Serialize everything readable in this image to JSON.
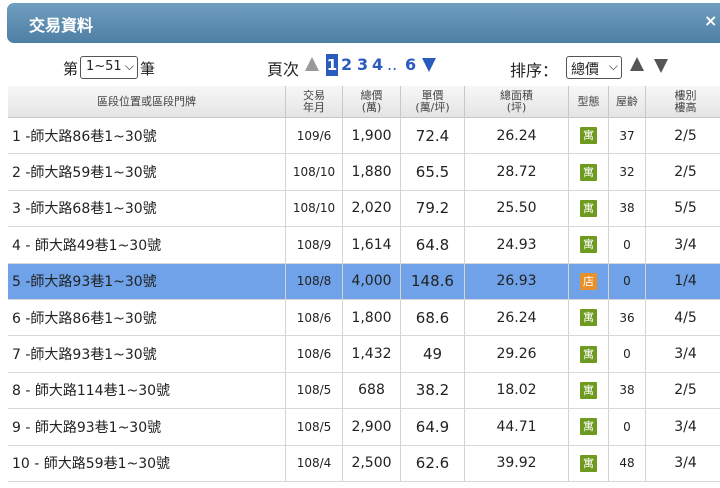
{
  "window": {
    "title": "交易資料",
    "close_glyph": "×"
  },
  "toolbar": {
    "range_prefix": "第",
    "range_value": "1~51",
    "range_suffix": "筆",
    "pager_label": "頁次",
    "current_page": "1",
    "pages": [
      "2",
      "3",
      "4"
    ],
    "ellipsis": "..",
    "last_page": "6",
    "sort_label": "排序：",
    "sort_value": "總價"
  },
  "icons": {
    "chevron": "chevron-down-icon",
    "prev": "triangle-up-icon",
    "next": "triangle-down-icon"
  },
  "colors": {
    "header_bar": "#5a88ad",
    "selected_row": "#6fa2e8",
    "link": "#2a5bbf",
    "badge_residential": "#6e9a1f",
    "badge_shop": "#e8902a"
  },
  "table": {
    "headers": [
      {
        "l1": "區段位置或區段門牌",
        "l2": ""
      },
      {
        "l1": "交易",
        "l2": "年月"
      },
      {
        "l1": "總價",
        "l2": "(萬)"
      },
      {
        "l1": "單價",
        "l2": "(萬/坪)"
      },
      {
        "l1": "總面積",
        "l2": "(坪)"
      },
      {
        "l1": "型態",
        "l2": ""
      },
      {
        "l1": "屋齡",
        "l2": ""
      },
      {
        "l1": "樓別",
        "l2": "樓高"
      }
    ],
    "rows": [
      {
        "address": "1  -師大路86巷1~30號",
        "date": "109/6",
        "total": "1,900",
        "unit": "72.4",
        "area": "26.24",
        "type": "寓",
        "age": "37",
        "floor": "2/5"
      },
      {
        "address": "2  -師大路59巷1~30號",
        "date": "108/10",
        "total": "1,880",
        "unit": "65.5",
        "area": "28.72",
        "type": "寓",
        "age": "32",
        "floor": "2/5"
      },
      {
        "address": "3  -師大路68巷1~30號",
        "date": "108/10",
        "total": "2,020",
        "unit": "79.2",
        "area": "25.50",
        "type": "寓",
        "age": "38",
        "floor": "5/5"
      },
      {
        "address": "4  - 師大路49巷1~30號",
        "date": "108/9",
        "total": "1,614",
        "unit": "64.8",
        "area": "24.93",
        "type": "寓",
        "age": "0",
        "floor": "3/4"
      },
      {
        "address": "5  -師大路93巷1~30號",
        "date": "108/8",
        "total": "4,000",
        "unit": "148.6",
        "area": "26.93",
        "type": "店",
        "age": "0",
        "floor": "1/4"
      },
      {
        "address": "6  -師大路86巷1~30號",
        "date": "108/6",
        "total": "1,800",
        "unit": "68.6",
        "area": "26.24",
        "type": "寓",
        "age": "36",
        "floor": "4/5"
      },
      {
        "address": "7  -師大路93巷1~30號",
        "date": "108/6",
        "total": "1,432",
        "unit": "49",
        "area": "29.26",
        "type": "寓",
        "age": "0",
        "floor": "3/4"
      },
      {
        "address": "8  - 師大路114巷1~30號",
        "date": "108/5",
        "total": "688",
        "unit": "38.2",
        "area": "18.02",
        "type": "寓",
        "age": "38",
        "floor": "2/5"
      },
      {
        "address": "9  - 師大路93巷1~30號",
        "date": "108/5",
        "total": "2,900",
        "unit": "64.9",
        "area": "44.71",
        "type": "寓",
        "age": "0",
        "floor": "3/4"
      },
      {
        "address": "10  - 師大路59巷1~30號",
        "date": "108/4",
        "total": "2,500",
        "unit": "62.6",
        "area": "39.92",
        "type": "寓",
        "age": "48",
        "floor": "3/4"
      }
    ]
  }
}
